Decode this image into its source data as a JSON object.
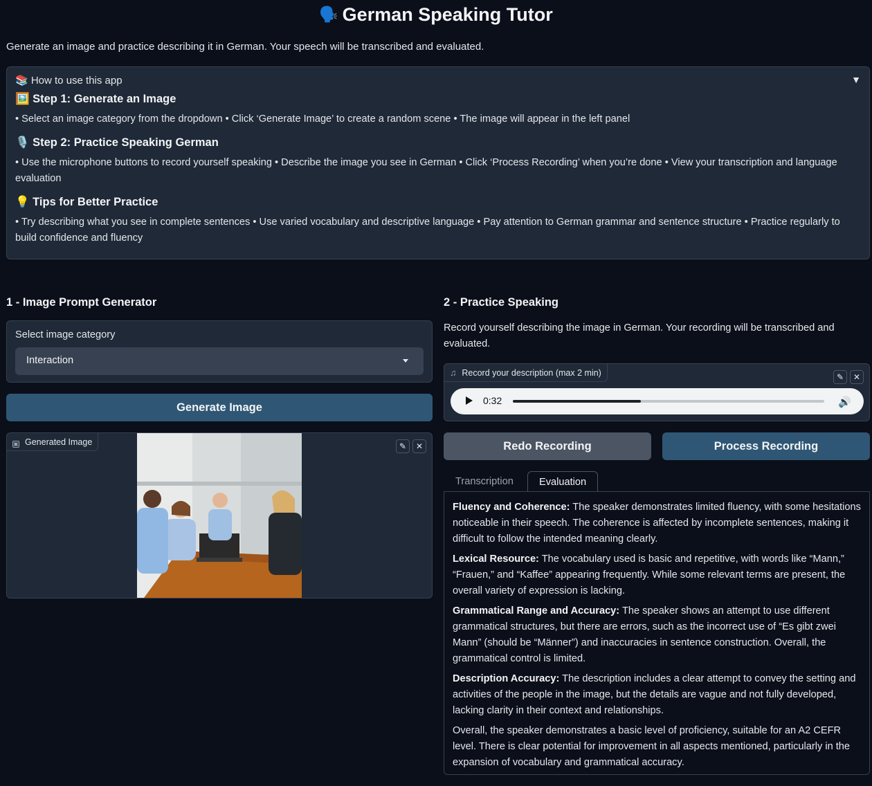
{
  "header": {
    "emoji": "🗣️",
    "title": "German Speaking Tutor",
    "subtitle": "Generate an image and practice describing it in German. Your speech will be transcribed and evaluated."
  },
  "howto": {
    "title": "📚 How to use this app",
    "toggle": "▼",
    "steps": [
      {
        "heading": "🖼️ Step 1: Generate an Image",
        "text": "• Select an image category from the dropdown • Click ‘Generate Image’ to create a random scene • The image will appear in the left panel"
      },
      {
        "heading": "🎙️ Step 2: Practice Speaking German",
        "text": "• Use the microphone buttons to record yourself speaking • Describe the image you see in German • Click ‘Process Recording’ when you’re done • View your transcription and language evaluation"
      },
      {
        "heading": "💡 Tips for Better Practice",
        "text": "• Try describing what you see in complete sentences • Use varied vocabulary and descriptive language • Pay attention to German grammar and sentence structure • Practice regularly to build confidence and fluency"
      }
    ]
  },
  "left": {
    "section_title": "1 - Image Prompt Generator",
    "select_label": "Select image category",
    "select_value": "Interaction",
    "generate_button": "Generate Image",
    "image_label": "Generated Image",
    "icon_image": "image-icon",
    "icon_edit": "pencil-icon",
    "icon_close": "close-icon"
  },
  "right": {
    "section_title": "2 - Practice Speaking",
    "description": "Record yourself describing the image in German. Your recording will be transcribed and evaluated.",
    "audio_label": "Record your description (max 2 min)",
    "audio_time": "0:32",
    "audio_progress": 0.41,
    "redo_button": "Redo Recording",
    "process_button": "Process Recording",
    "tabs": [
      "Transcription",
      "Evaluation"
    ],
    "active_tab": "Evaluation",
    "evaluation": [
      {
        "label": "Fluency and Coherence:",
        "text": " The speaker demonstrates limited fluency, with some hesitations noticeable in their speech. The coherence is affected by incomplete sentences, making it difficult to follow the intended meaning clearly."
      },
      {
        "label": "Lexical Resource:",
        "text": " The vocabulary used is basic and repetitive, with words like “Mann,” “Frauen,” and “Kaffee” appearing frequently. While some relevant terms are present, the overall variety of expression is lacking."
      },
      {
        "label": "Grammatical Range and Accuracy:",
        "text": " The speaker shows an attempt to use different grammatical structures, but there are errors, such as the incorrect use of “Es gibt zwei Mann” (should be “Männer”) and inaccuracies in sentence construction. Overall, the grammatical control is limited."
      },
      {
        "label": "Description Accuracy:",
        "text": " The description includes a clear attempt to convey the setting and activities of the people in the image, but the details are vague and not fully developed, lacking clarity in their context and relationships."
      },
      {
        "label": "",
        "text": "Overall, the speaker demonstrates a basic level of proficiency, suitable for an A2 CEFR level. There is clear potential for improvement in all aspects mentioned, particularly in the expansion of vocabulary and grammatical accuracy."
      }
    ]
  },
  "colors": {
    "background": "#0b0f19",
    "panel": "#1f2937",
    "primary_button": "#2f5775",
    "secondary_button": "#4b5563"
  }
}
